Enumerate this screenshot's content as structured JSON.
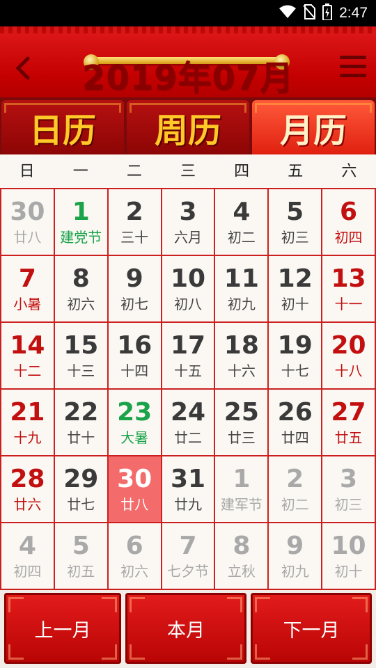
{
  "status_bar": {
    "time": "2:47",
    "icons": [
      "wifi-icon",
      "no-sim-icon",
      "battery-charging-icon"
    ]
  },
  "header": {
    "title": "2019年07月",
    "back_icon": "chevron-left-icon",
    "menu_icon": "menu-icon"
  },
  "tabs": [
    {
      "label": "日历",
      "active": false
    },
    {
      "label": "周历",
      "active": false
    },
    {
      "label": "月历",
      "active": true
    }
  ],
  "weekdays": [
    "日",
    "一",
    "二",
    "三",
    "四",
    "五",
    "六"
  ],
  "days": [
    {
      "num": "30",
      "sub": "廿八",
      "kind": "other"
    },
    {
      "num": "1",
      "sub": "建党节",
      "kind": "festival"
    },
    {
      "num": "2",
      "sub": "三十",
      "kind": ""
    },
    {
      "num": "3",
      "sub": "六月",
      "kind": ""
    },
    {
      "num": "4",
      "sub": "初二",
      "kind": ""
    },
    {
      "num": "5",
      "sub": "初三",
      "kind": ""
    },
    {
      "num": "6",
      "sub": "初四",
      "kind": "weekend"
    },
    {
      "num": "7",
      "sub": "小暑",
      "kind": "weekend"
    },
    {
      "num": "8",
      "sub": "初六",
      "kind": ""
    },
    {
      "num": "9",
      "sub": "初七",
      "kind": ""
    },
    {
      "num": "10",
      "sub": "初八",
      "kind": ""
    },
    {
      "num": "11",
      "sub": "初九",
      "kind": ""
    },
    {
      "num": "12",
      "sub": "初十",
      "kind": ""
    },
    {
      "num": "13",
      "sub": "十一",
      "kind": "weekend"
    },
    {
      "num": "14",
      "sub": "十二",
      "kind": "weekend"
    },
    {
      "num": "15",
      "sub": "十三",
      "kind": ""
    },
    {
      "num": "16",
      "sub": "十四",
      "kind": ""
    },
    {
      "num": "17",
      "sub": "十五",
      "kind": ""
    },
    {
      "num": "18",
      "sub": "十六",
      "kind": ""
    },
    {
      "num": "19",
      "sub": "十七",
      "kind": ""
    },
    {
      "num": "20",
      "sub": "十八",
      "kind": "weekend"
    },
    {
      "num": "21",
      "sub": "十九",
      "kind": "weekend"
    },
    {
      "num": "22",
      "sub": "廿十",
      "kind": ""
    },
    {
      "num": "23",
      "sub": "大暑",
      "kind": "festival"
    },
    {
      "num": "24",
      "sub": "廿二",
      "kind": ""
    },
    {
      "num": "25",
      "sub": "廿三",
      "kind": ""
    },
    {
      "num": "26",
      "sub": "廿四",
      "kind": ""
    },
    {
      "num": "27",
      "sub": "廿五",
      "kind": "weekend"
    },
    {
      "num": "28",
      "sub": "廿六",
      "kind": "weekend"
    },
    {
      "num": "29",
      "sub": "廿七",
      "kind": ""
    },
    {
      "num": "30",
      "sub": "廿八",
      "kind": "today"
    },
    {
      "num": "31",
      "sub": "廿九",
      "kind": ""
    },
    {
      "num": "1",
      "sub": "建军节",
      "kind": "other"
    },
    {
      "num": "2",
      "sub": "初二",
      "kind": "other"
    },
    {
      "num": "3",
      "sub": "初三",
      "kind": "other"
    },
    {
      "num": "4",
      "sub": "初四",
      "kind": "other"
    },
    {
      "num": "5",
      "sub": "初五",
      "kind": "other"
    },
    {
      "num": "6",
      "sub": "初六",
      "kind": "other"
    },
    {
      "num": "7",
      "sub": "七夕节",
      "kind": "other"
    },
    {
      "num": "8",
      "sub": "立秋",
      "kind": "other"
    },
    {
      "num": "9",
      "sub": "初九",
      "kind": "other"
    },
    {
      "num": "10",
      "sub": "初十",
      "kind": "other"
    }
  ],
  "buttons": {
    "prev": "上一月",
    "current": "本月",
    "next": "下一月"
  },
  "colors": {
    "primary_red": "#c40000",
    "weekend_red": "#c20f0f",
    "festival_green": "#1aa34a",
    "today_bg": "#f36b6b",
    "gold": "#ffc928"
  }
}
